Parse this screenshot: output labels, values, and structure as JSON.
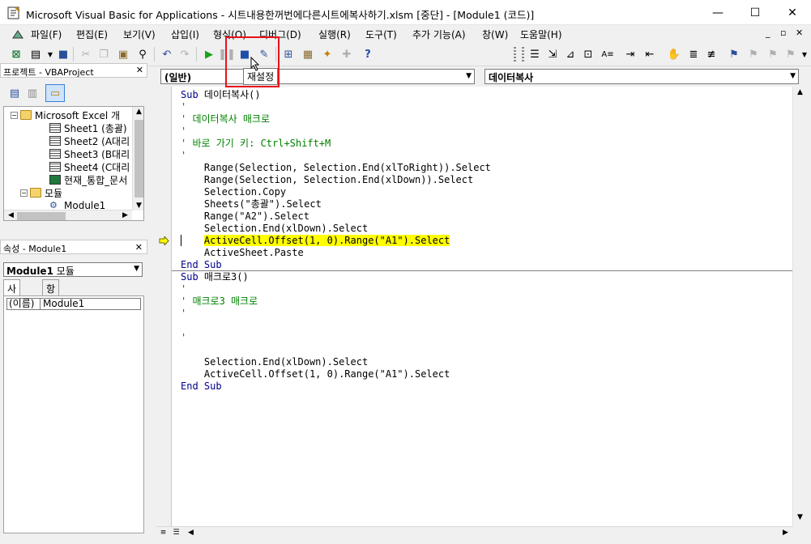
{
  "window": {
    "title": "Microsoft Visual Basic for Applications - 시트내용한꺼번에다른시트에복사하기.xlsm [중단] - [Module1 (코드)]",
    "min_label": "—",
    "max_label": "☐",
    "close_label": "✕"
  },
  "menubar": {
    "items": [
      "파일(F)",
      "편집(E)",
      "보기(V)",
      "삽입(I)",
      "형식(O)",
      "디버그(D)",
      "실행(R)",
      "도구(T)",
      "추가 기능(A)",
      "창(W)",
      "도움말(H)"
    ],
    "mdi_min": "_",
    "mdi_restore": "▫",
    "mdi_close": "✕"
  },
  "toolbar": {
    "tooltip": "재설정"
  },
  "project_pane": {
    "title": "프로젝트 - VBAProject",
    "close": "✕",
    "tree": [
      {
        "label": "Microsoft Excel 개",
        "type": "folder"
      },
      {
        "label": "Sheet1 (총괄)",
        "type": "sheet"
      },
      {
        "label": "Sheet2 (A대리",
        "type": "sheet"
      },
      {
        "label": "Sheet3 (B대리",
        "type": "sheet"
      },
      {
        "label": "Sheet4 (C대리",
        "type": "sheet"
      },
      {
        "label": "현재_통합_문서",
        "type": "workbook"
      },
      {
        "label": "모듈",
        "type": "folder"
      },
      {
        "label": "Module1",
        "type": "module"
      }
    ]
  },
  "properties_pane": {
    "title": "속성 - Module1",
    "close": "✕",
    "combo_name": "Module1",
    "combo_type": "모듈",
    "tabs": [
      "사전순",
      "항목별"
    ],
    "rows": [
      {
        "name": "(이름)",
        "value": "Module1"
      }
    ]
  },
  "code_window": {
    "object_combo": "(일반)",
    "proc_combo": "데이터복사",
    "lines": [
      {
        "text": "Sub 데이터복사()",
        "style": "sub"
      },
      {
        "text": "'",
        "style": "comment"
      },
      {
        "text": "' 데이터복사 매크로",
        "style": "comment"
      },
      {
        "text": "'",
        "style": "comment"
      },
      {
        "text": "' 바로 가기 키: Ctrl+Shift+M",
        "style": "comment"
      },
      {
        "text": "'",
        "style": "comment"
      },
      {
        "text": "    Range(Selection, Selection.End(xlToRight)).Select",
        "style": "code"
      },
      {
        "text": "    Range(Selection, Selection.End(xlDown)).Select",
        "style": "code"
      },
      {
        "text": "    Selection.Copy",
        "style": "code"
      },
      {
        "text": "    Sheets(\"총괄\").Select",
        "style": "code"
      },
      {
        "text": "    Range(\"A2\").Select",
        "style": "code"
      },
      {
        "text": "    Selection.End(xlDown).Select",
        "style": "code"
      },
      {
        "text": "    ActiveCell.Offset(1, 0).Range(\"A1\").Select",
        "style": "highlight"
      },
      {
        "text": "    ActiveSheet.Paste",
        "style": "code"
      },
      {
        "text": "End Sub",
        "style": "kw"
      },
      {
        "text": "Sub 매크로3()",
        "style": "sub"
      },
      {
        "text": "'",
        "style": "comment"
      },
      {
        "text": "' 매크로3 매크로",
        "style": "comment"
      },
      {
        "text": "'",
        "style": "comment"
      },
      {
        "text": "",
        "style": "code"
      },
      {
        "text": "'",
        "style": "comment"
      },
      {
        "text": "",
        "style": "code"
      },
      {
        "text": "    Selection.End(xlDown).Select",
        "style": "code"
      },
      {
        "text": "    ActiveCell.Offset(1, 0).Range(\"A1\").Select",
        "style": "code"
      },
      {
        "text": "End Sub",
        "style": "kw"
      }
    ]
  },
  "colors": {
    "keyword": "#00008b",
    "comment": "#008000",
    "highlight": "#ffff00",
    "annotation_box": "#e8111a"
  }
}
